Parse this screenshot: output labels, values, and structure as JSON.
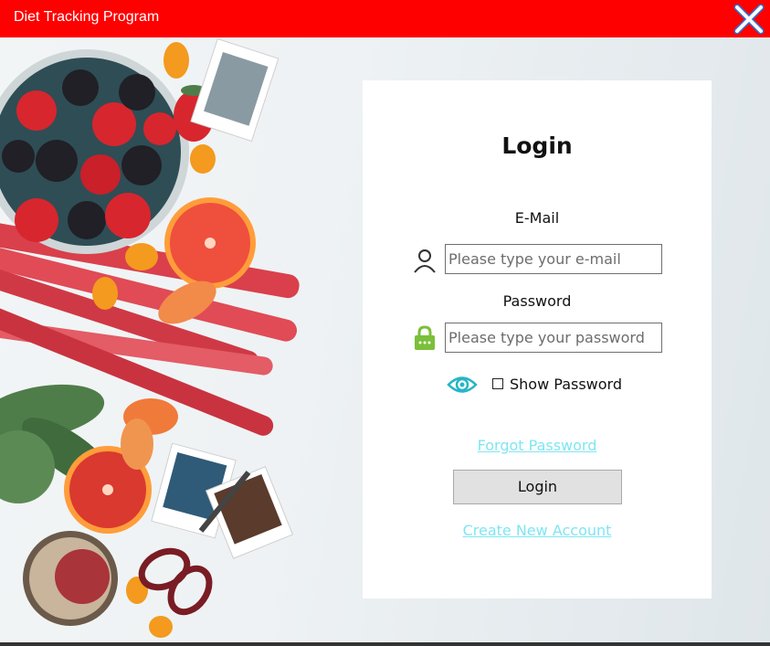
{
  "window": {
    "title": "Diet Tracking Program",
    "close_icon": "close-icon"
  },
  "login": {
    "heading": "Login",
    "email_label": "E-Mail",
    "email_placeholder": "Please type your e-mail",
    "email_value": "",
    "password_label": "Password",
    "password_placeholder": "Please type your password",
    "password_value": "",
    "show_password_label": "Show Password",
    "show_password_checked": false,
    "forgot_password_link": "Forgot Password",
    "login_button": "Login",
    "create_account_link": "Create New Account"
  },
  "colors": {
    "titlebar": "#ff0000",
    "link": "#7fe6f2",
    "eye_icon": "#26b5c8",
    "lock_icon": "#7bbf3a"
  }
}
